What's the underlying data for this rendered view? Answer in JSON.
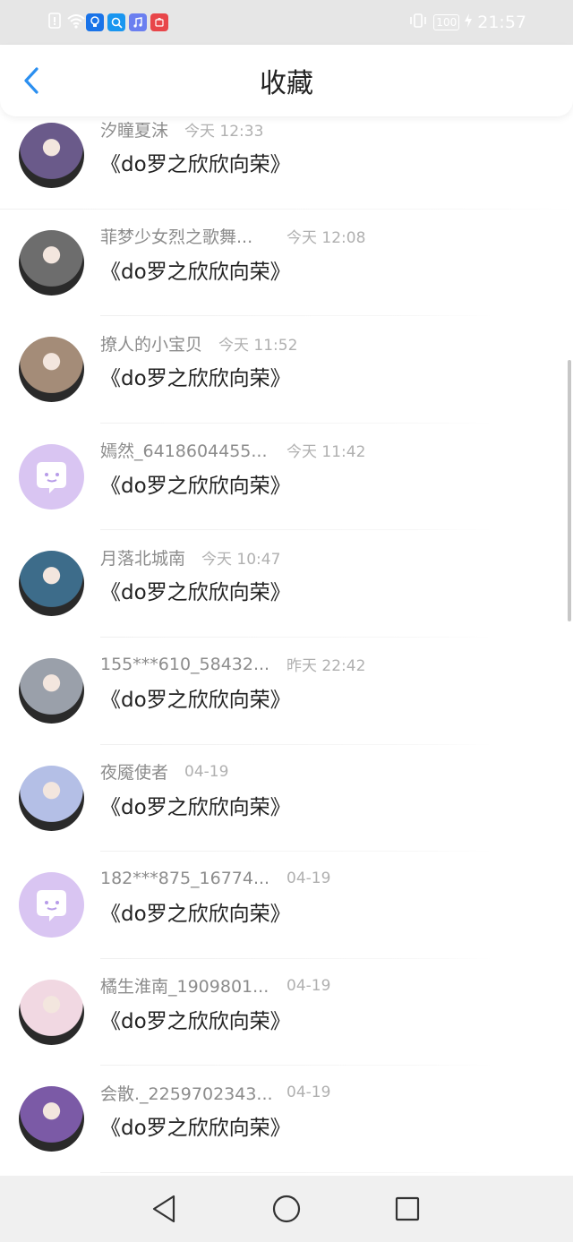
{
  "status_bar": {
    "time": "21:57",
    "battery": "100",
    "left_icons": [
      "sim-icon",
      "wifi-icon",
      "app-bulb-icon",
      "app-search-icon",
      "app-music-icon",
      "huawei-store-icon"
    ],
    "right_icons": [
      "vibrate-icon",
      "battery-icon",
      "charging-icon"
    ]
  },
  "header": {
    "title": "收藏",
    "accent": "#2b8ff0"
  },
  "items": [
    {
      "name": "汐瞳夏沫",
      "time": "今天 12:33",
      "content": "《do罗之欣欣向荣》",
      "avatar_color": "#6a5a8a"
    },
    {
      "name": "菲梦少女烈之歌舞...",
      "time": "今天 12:08",
      "content": "《do罗之欣欣向荣》",
      "avatar_color": "#6d6d6d"
    },
    {
      "name": "撩人的小宝贝",
      "time": "今天 11:52",
      "content": "《do罗之欣欣向荣》",
      "avatar_color": "#a48c78"
    },
    {
      "name": "嫣然_6418604455...",
      "time": "今天 11:42",
      "content": "《do罗之欣欣向荣》",
      "avatar_color": "#d9c5f2"
    },
    {
      "name": "月落北城南",
      "time": "今天 10:47",
      "content": "《do罗之欣欣向荣》",
      "avatar_color": "#3d6c8a"
    },
    {
      "name": "155***610_58432...",
      "time": "昨天 22:42",
      "content": "《do罗之欣欣向荣》",
      "avatar_color": "#9aa0aa"
    },
    {
      "name": "夜魇使者",
      "time": "04-19",
      "content": "《do罗之欣欣向荣》",
      "avatar_color": "#b4bfe6"
    },
    {
      "name": "182***875_16774...",
      "time": "04-19",
      "content": "《do罗之欣欣向荣》",
      "avatar_color": "#d9c5f2"
    },
    {
      "name": "橘生淮南_1909801...",
      "time": "04-19",
      "content": "《do罗之欣欣向荣》",
      "avatar_color": "#f1d8e2"
    },
    {
      "name": "会散._2259702343...",
      "time": "04-19",
      "content": "《do罗之欣欣向荣》",
      "avatar_color": "#7b5aa6"
    }
  ],
  "nav": {
    "buttons": [
      "back-triangle-icon",
      "home-circle-icon",
      "recents-square-icon"
    ]
  }
}
